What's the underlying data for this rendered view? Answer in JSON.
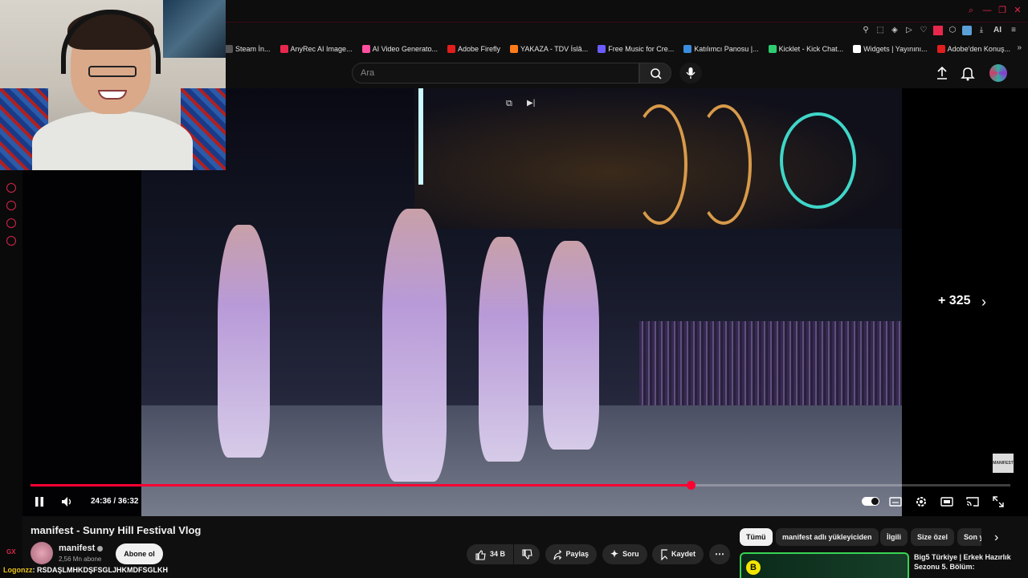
{
  "browser": {
    "bookmarks": [
      {
        "label": "Steam İn...",
        "color": "#555555"
      },
      {
        "label": "AnyRec AI Image...",
        "color": "#e8274d"
      },
      {
        "label": "AI Video Generato...",
        "color": "#ff4fa0"
      },
      {
        "label": "Adobe Firefly",
        "color": "#e01e1e"
      },
      {
        "label": "YAKAZA - TDV İslâ...",
        "color": "#ff7a1a"
      },
      {
        "label": "Free Music for Cre...",
        "color": "#6b5cff"
      },
      {
        "label": "Katılımcı Panosu |...",
        "color": "#3a8dde"
      },
      {
        "label": "Kicklet - Kick Chat...",
        "color": "#2ecc71"
      },
      {
        "label": "Widgets | Yayınını...",
        "color": "#ffffff"
      },
      {
        "label": "Adobe'den Konuş...",
        "color": "#e01e1e"
      }
    ],
    "toolbar_icons": [
      "pin-icon",
      "screenshot-icon",
      "shield-icon",
      "play-icon",
      "heart-icon",
      "extensions-icon",
      "photo-icon",
      "download-icon",
      "ai-icon",
      "menu-icon"
    ],
    "ai_label": "AI",
    "accent": "#e8274d"
  },
  "youtube": {
    "search": {
      "placeholder": "Ara"
    },
    "video": {
      "current_time": "24:36",
      "duration": "36:32",
      "timecode": "24:36 / 36:32",
      "progress": 0.6736,
      "end_screen_count": "+ 325",
      "watermark": "MANIFEST"
    },
    "title": "manifest - Sunny Hill Festival Vlog",
    "channel": {
      "name": "manifest",
      "subscribers": "2,56 Mn abone",
      "subscribe_label": "Abone ol"
    },
    "actions": {
      "likes": "34 B",
      "share": "Paylaş",
      "ask": "Soru",
      "save": "Kaydet",
      "more": "⋯"
    },
    "chips": [
      "Tümü",
      "manifest adlı yükleyiciden",
      "İlgili",
      "Size özel",
      "Son y"
    ],
    "recommendation": {
      "title": "Big5 Türkiye | Erkek Hazırlık Sezonu 5. Bölüm:",
      "logo": "B"
    }
  },
  "overlay": {
    "chat_user": "Logonzz",
    "chat_message": "RSDAŞLMHKDŞFSGLJHKMDFSGLKH",
    "gx_label": "GX"
  }
}
